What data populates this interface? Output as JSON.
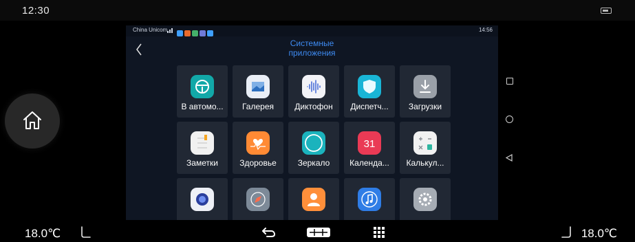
{
  "car_status": {
    "time": "12:30",
    "battery_icon": "battery-icon"
  },
  "phone": {
    "carrier": "China Unicom",
    "status_right": "14:56",
    "title_line1": "Системные",
    "title_line2": "приложения",
    "apps": [
      {
        "label": "В автомо...",
        "icon": "steering-wheel-icon",
        "color": "#12a8a8"
      },
      {
        "label": "Галерея",
        "icon": "gallery-icon",
        "color": "#e9eef6"
      },
      {
        "label": "Диктофон",
        "icon": "voice-recorder-icon",
        "color": "#f3f3f7"
      },
      {
        "label": "Диспетч...",
        "icon": "shield-icon",
        "color": "#19b5d6"
      },
      {
        "label": "Загрузки",
        "icon": "download-icon",
        "color": "#9aa0a8"
      },
      {
        "label": "Заметки",
        "icon": "notes-icon",
        "color": "#f1f1f1"
      },
      {
        "label": "Здоровье",
        "icon": "health-icon",
        "color": "#ff8a34"
      },
      {
        "label": "Зеркало",
        "icon": "mirror-icon",
        "color": "#1bb3bd"
      },
      {
        "label": "Календа...",
        "icon": "calendar-icon",
        "color": "#ea3a55"
      },
      {
        "label": "Калькул...",
        "icon": "calculator-icon",
        "color": "#f1f1f1"
      },
      {
        "label": "",
        "icon": "camera-icon",
        "color": "#eef0f6"
      },
      {
        "label": "",
        "icon": "compass-icon",
        "color": "#7d8a98"
      },
      {
        "label": "",
        "icon": "contacts-icon",
        "color": "#ff8f3a"
      },
      {
        "label": "",
        "icon": "music-icon",
        "color": "#2f7de6"
      },
      {
        "label": "",
        "icon": "settings-icon",
        "color": "#a6acb4"
      }
    ]
  },
  "bottom": {
    "temp_left": "18.0℃",
    "temp_right": "18.0℃"
  }
}
